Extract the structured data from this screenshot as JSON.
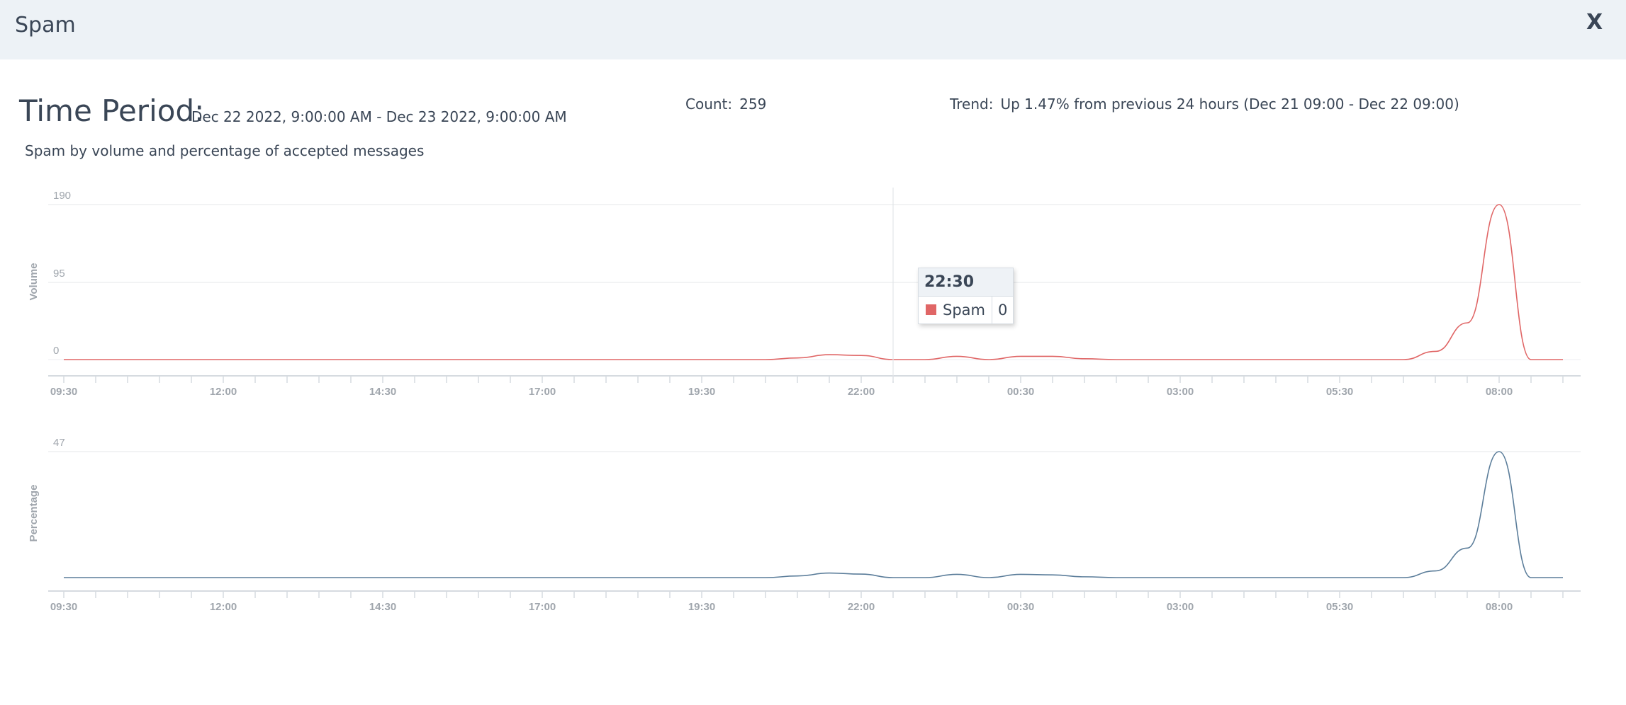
{
  "header": {
    "title": "Spam",
    "close_label": "X"
  },
  "summary": {
    "period_label": "Time Period:",
    "period_value": "Dec 22 2022, 9:00:00 AM - Dec 23 2022, 9:00:00 AM",
    "count_label": "Count:",
    "count_value": "259",
    "trend_label": "Trend:",
    "trend_value": "Up 1.47% from previous 24 hours (Dec 21 09:00 - Dec 22 09:00)"
  },
  "subtitle": "Spam by volume and percentage of accepted messages",
  "tooltip": {
    "time": "22:30",
    "series": "Spam",
    "value": "0",
    "color": "#e06666"
  },
  "chart_data": [
    {
      "type": "line",
      "ylabel": "Volume",
      "y_ticks": [
        "190",
        "95",
        "0"
      ],
      "ylim": [
        0,
        190
      ],
      "x_ticks": [
        "09:30",
        "12:00",
        "14:30",
        "17:00",
        "19:30",
        "22:00",
        "00:30",
        "03:00",
        "05:30",
        "08:00"
      ],
      "series": [
        {
          "name": "Spam",
          "color": "#e06666",
          "points": [
            [
              "09:30",
              0
            ],
            [
              "20:30",
              0
            ],
            [
              "21:00",
              2
            ],
            [
              "21:30",
              6
            ],
            [
              "22:00",
              5
            ],
            [
              "22:30",
              0
            ],
            [
              "23:00",
              0
            ],
            [
              "23:30",
              4
            ],
            [
              "00:00",
              0
            ],
            [
              "00:30",
              4
            ],
            [
              "01:00",
              4
            ],
            [
              "01:30",
              1
            ],
            [
              "02:00",
              0
            ],
            [
              "06:30",
              0
            ],
            [
              "07:00",
              10
            ],
            [
              "07:30",
              45
            ],
            [
              "08:00",
              190
            ],
            [
              "08:30",
              0
            ],
            [
              "09:00",
              0
            ]
          ]
        }
      ]
    },
    {
      "type": "line",
      "ylabel": "Percentage",
      "y_ticks": [
        "47"
      ],
      "ylim": [
        0,
        47
      ],
      "x_ticks": [
        "09:30",
        "12:00",
        "14:30",
        "17:00",
        "19:30",
        "22:00",
        "00:30",
        "03:00",
        "05:30",
        "08:00"
      ],
      "series": [
        {
          "name": "",
          "color": "#5b7d9a",
          "points": [
            [
              "09:30",
              0
            ],
            [
              "20:30",
              0
            ],
            [
              "21:00",
              0.6
            ],
            [
              "21:30",
              1.7
            ],
            [
              "22:00",
              1.3
            ],
            [
              "22:30",
              0
            ],
            [
              "23:00",
              0
            ],
            [
              "23:30",
              1.2
            ],
            [
              "00:00",
              0
            ],
            [
              "00:30",
              1.2
            ],
            [
              "01:00",
              1.0
            ],
            [
              "01:30",
              0.3
            ],
            [
              "02:00",
              0
            ],
            [
              "06:30",
              0
            ],
            [
              "07:00",
              2.5
            ],
            [
              "07:30",
              11
            ],
            [
              "08:00",
              47
            ],
            [
              "08:30",
              0
            ],
            [
              "09:00",
              0
            ]
          ]
        }
      ]
    }
  ]
}
